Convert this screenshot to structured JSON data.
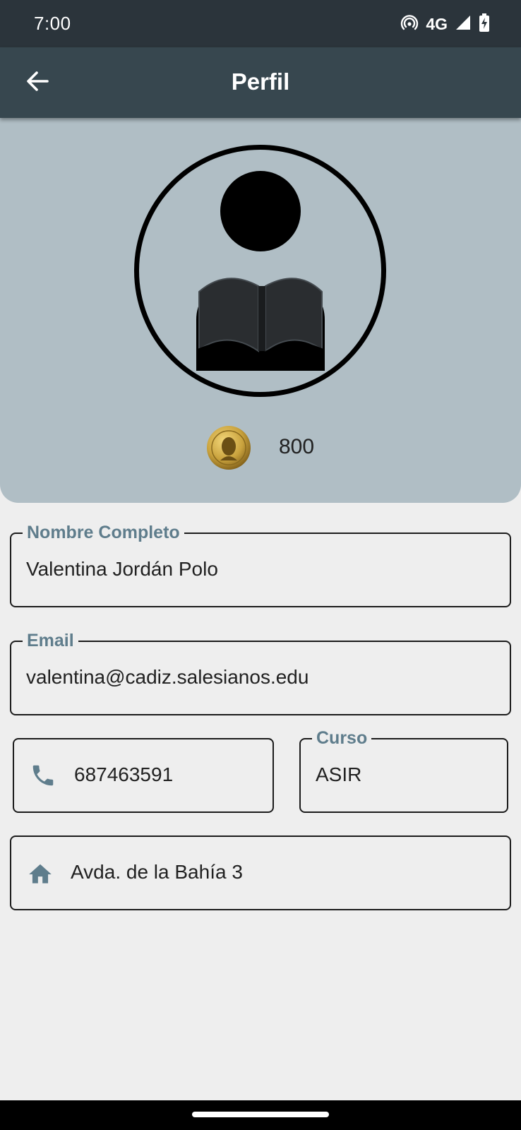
{
  "status_bar": {
    "time": "7:00",
    "network": "4G",
    "icons": [
      "hotspot-icon",
      "signal-icon",
      "battery-charging-icon"
    ]
  },
  "app_bar": {
    "title": "Perfil",
    "back_icon": "arrow-back-icon"
  },
  "profile": {
    "avatar_icon": "reader-avatar-icon",
    "medal_icon": "gold-medal-icon",
    "points": "800"
  },
  "fields": {
    "full_name": {
      "label": "Nombre Completo",
      "value": "Valentina Jordán Polo"
    },
    "email": {
      "label": "Email",
      "value": "valentina@cadiz.salesianos.edu"
    },
    "phone": {
      "icon": "phone-icon",
      "value": "687463591"
    },
    "course": {
      "label": "Curso",
      "value": "ASIR"
    },
    "address": {
      "icon": "home-icon",
      "value": "Avda. de la Bahía 3"
    }
  },
  "colors": {
    "status_bar": "#2b343b",
    "app_bar": "#37474f",
    "header_panel": "#b0bec5",
    "label": "#5f7d8c",
    "background": "#eeeeee"
  }
}
